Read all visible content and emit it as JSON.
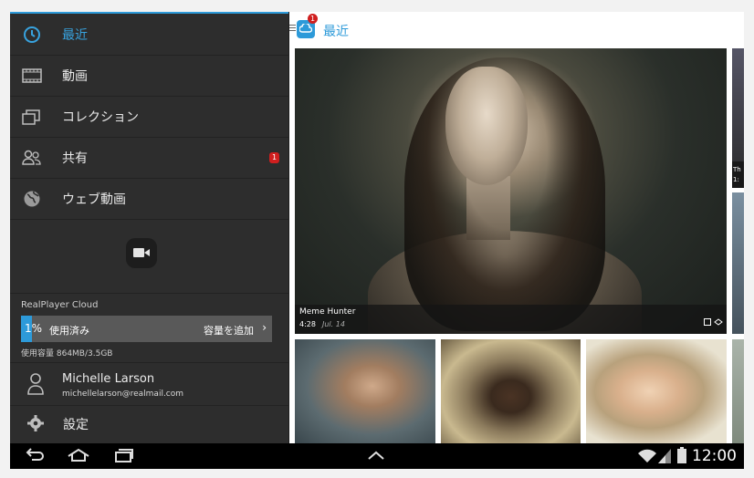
{
  "drawer": {
    "items": [
      {
        "label": "最近",
        "icon": "clock-icon",
        "active": true
      },
      {
        "label": "動画",
        "icon": "film-icon"
      },
      {
        "label": "コレクション",
        "icon": "collection-icon"
      },
      {
        "label": "共有",
        "icon": "share-people-icon",
        "badge": "1"
      },
      {
        "label": "ウェブ動画",
        "icon": "globe-icon"
      }
    ],
    "camera_icon": "video-camera-icon",
    "cloud": {
      "title": "RealPlayer Cloud",
      "percent": "1%",
      "used_fraction": 0.01,
      "used_label": "使用済み",
      "add_label": "容量を追加",
      "capacity": "使用容量 864MB/3.5GB"
    },
    "user": {
      "name": "Michelle Larson",
      "email": "michellelarson@realmail.com"
    },
    "settings_label": "設定"
  },
  "appbar": {
    "title": "最近",
    "badge": "1"
  },
  "videos": {
    "hero": {
      "title": "Meme Hunter",
      "duration": "4:28",
      "date": "Jul. 14"
    },
    "side_caption": "Th\n1:"
  },
  "system": {
    "time": "12:00"
  },
  "colors": {
    "accent": "#2d9ad9",
    "badge": "#d01f1f",
    "drawer_bg": "#2d2d2d"
  }
}
